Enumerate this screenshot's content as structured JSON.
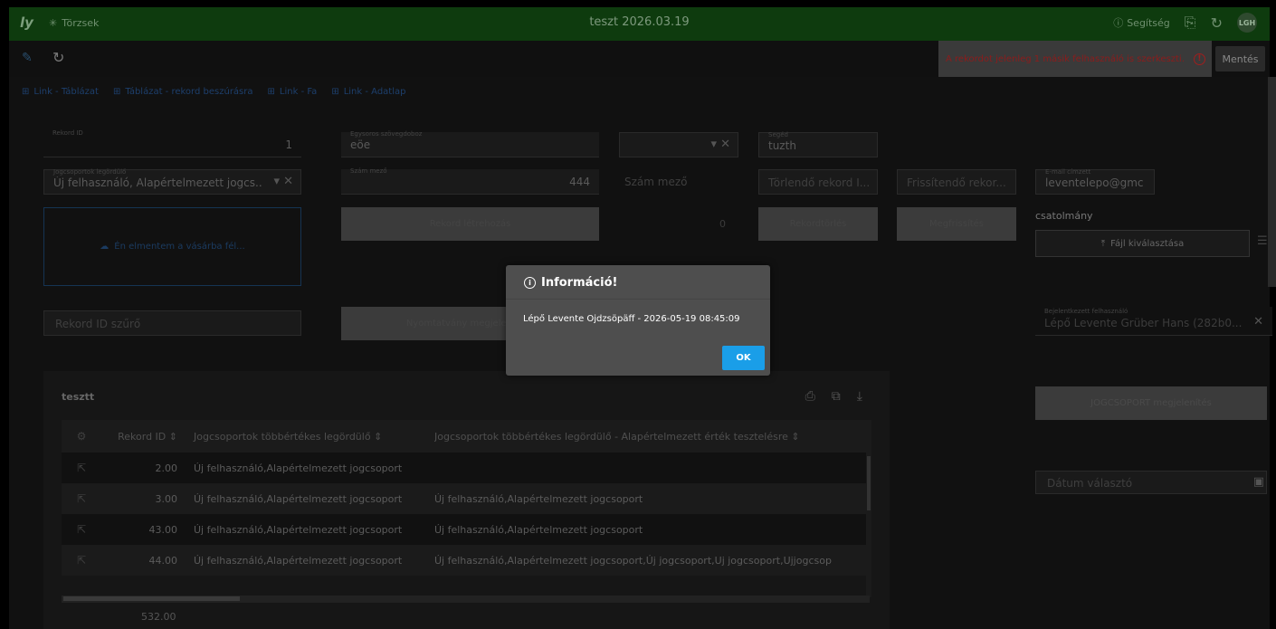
{
  "titlebar": {
    "logo": "ly",
    "menu_label": "Törzsek",
    "window_title": "teszt 2026.03.19",
    "help_label": "Segítség",
    "avatar_initials": "LGH"
  },
  "toolbar": {
    "warning_text": "A rekordot jelenleg 1 másik felhasználó is szerkeszti.",
    "save_label": "Mentés"
  },
  "links": [
    "Link - Táblázat",
    "Táblázat - rekord beszúrásra",
    "Link - Fa",
    "Link - Adatlap"
  ],
  "form": {
    "rekord_id_label": "Rekord ID",
    "rekord_id_value": "1",
    "egysoros_label": "Egysoros szövegdoboz",
    "egysoros_value": "eöe",
    "seged_label": "Segéd",
    "seged_value": "tuzth",
    "jogcsoport_label": "Jogcsoportok legördülő",
    "jogcsoport_value": "Új felhasználó, Alapértelmezett jogcs...",
    "szam_label": "Szám mező",
    "szam_value": "444",
    "szam_placeholder": "Szám mező",
    "torlendo_placeholder": "Törlendő rekord I...",
    "frissitendo_placeholder": "Frissítendő rekor...",
    "email_label": "E-mail címzett",
    "email_value": "leventelepo@gmc",
    "dropzone_text": "Én elmentem a vásárba fél...",
    "rekord_letrehozas": "Rekord létrehozás",
    "counter_value": "0",
    "rekordtorles": "Rekordtörlés",
    "megfrissites": "Megfrissítés",
    "csatolmany_label": "csatolmány",
    "fajl_kivalasztasa": "Fájl kiválasztása",
    "rekord_id_szuro": "Rekord ID szűrő",
    "nyomtatvany": "Nyomtatvány megjelenítése",
    "bejelentkezett_label": "Bejelentkezett felhasználó",
    "bejelentkezett_value": "Lépő Levente Grüber Hans (282b0...",
    "jogcsoport_megjelenites": "JOGCSOPORT megjelenítés",
    "datum_placeholder": "Dátum választó"
  },
  "table": {
    "title": "tesztt",
    "headers": {
      "rekord_id": "Rekord ID",
      "multi": "Jogcsoportok többértékes legördülő",
      "multi_default": "Jogcsoportok többértékes legördülő - Alapértelmezett érték tesztelésre"
    },
    "rows": [
      {
        "id": "2.00",
        "multi": "Új felhasználó,Alapértelmezett jogcsoport",
        "multi_default": ""
      },
      {
        "id": "3.00",
        "multi": "Új felhasználó,Alapértelmezett jogcsoport",
        "multi_default": "Új felhasználó,Alapértelmezett jogcsoport"
      },
      {
        "id": "43.00",
        "multi": "Új felhasználó,Alapértelmezett jogcsoport",
        "multi_default": "Új felhasználó,Alapértelmezett jogcsoport"
      },
      {
        "id": "44.00",
        "multi": "Új felhasználó,Alapértelmezett jogcsoport",
        "multi_default": "Új felhasználó,Alapértelmezett jogcsoport,Új jogcsoport,Uj jogcsoport,Ujjogcsop"
      }
    ],
    "last_id": "532.00"
  },
  "modal": {
    "title": "Információ!",
    "body": "Lépő Levente Ojdzsöpäff - 2026-05-19 08:45:09",
    "ok_label": "OK"
  },
  "colors": {
    "titlebar_bg": "#0e3b0e",
    "ok_button": "#1a9ee8",
    "warning_text": "#8c1c1c"
  }
}
